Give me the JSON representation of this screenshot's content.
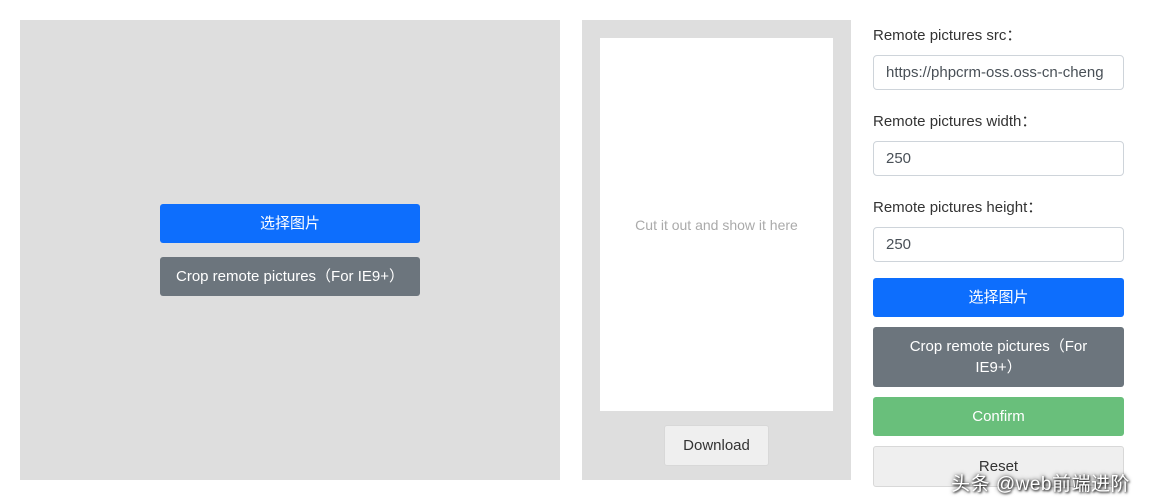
{
  "left": {
    "choose_label": "选择图片",
    "crop_label": "Crop remote pictures（For IE9+）"
  },
  "middle": {
    "preview_text": "Cut it out and show it here",
    "download_label": "Download"
  },
  "right": {
    "src_label": "Remote pictures src：",
    "src_value": "https://phpcrm-oss.oss-cn-cheng",
    "width_label": "Remote pictures width：",
    "width_value": "250",
    "height_label": "Remote pictures height：",
    "height_value": "250",
    "choose_label": "选择图片",
    "crop_label": "Crop remote pictures（For IE9+）",
    "confirm_label": "Confirm",
    "reset_label": "Reset"
  },
  "watermark": "头条 @web前端进阶"
}
